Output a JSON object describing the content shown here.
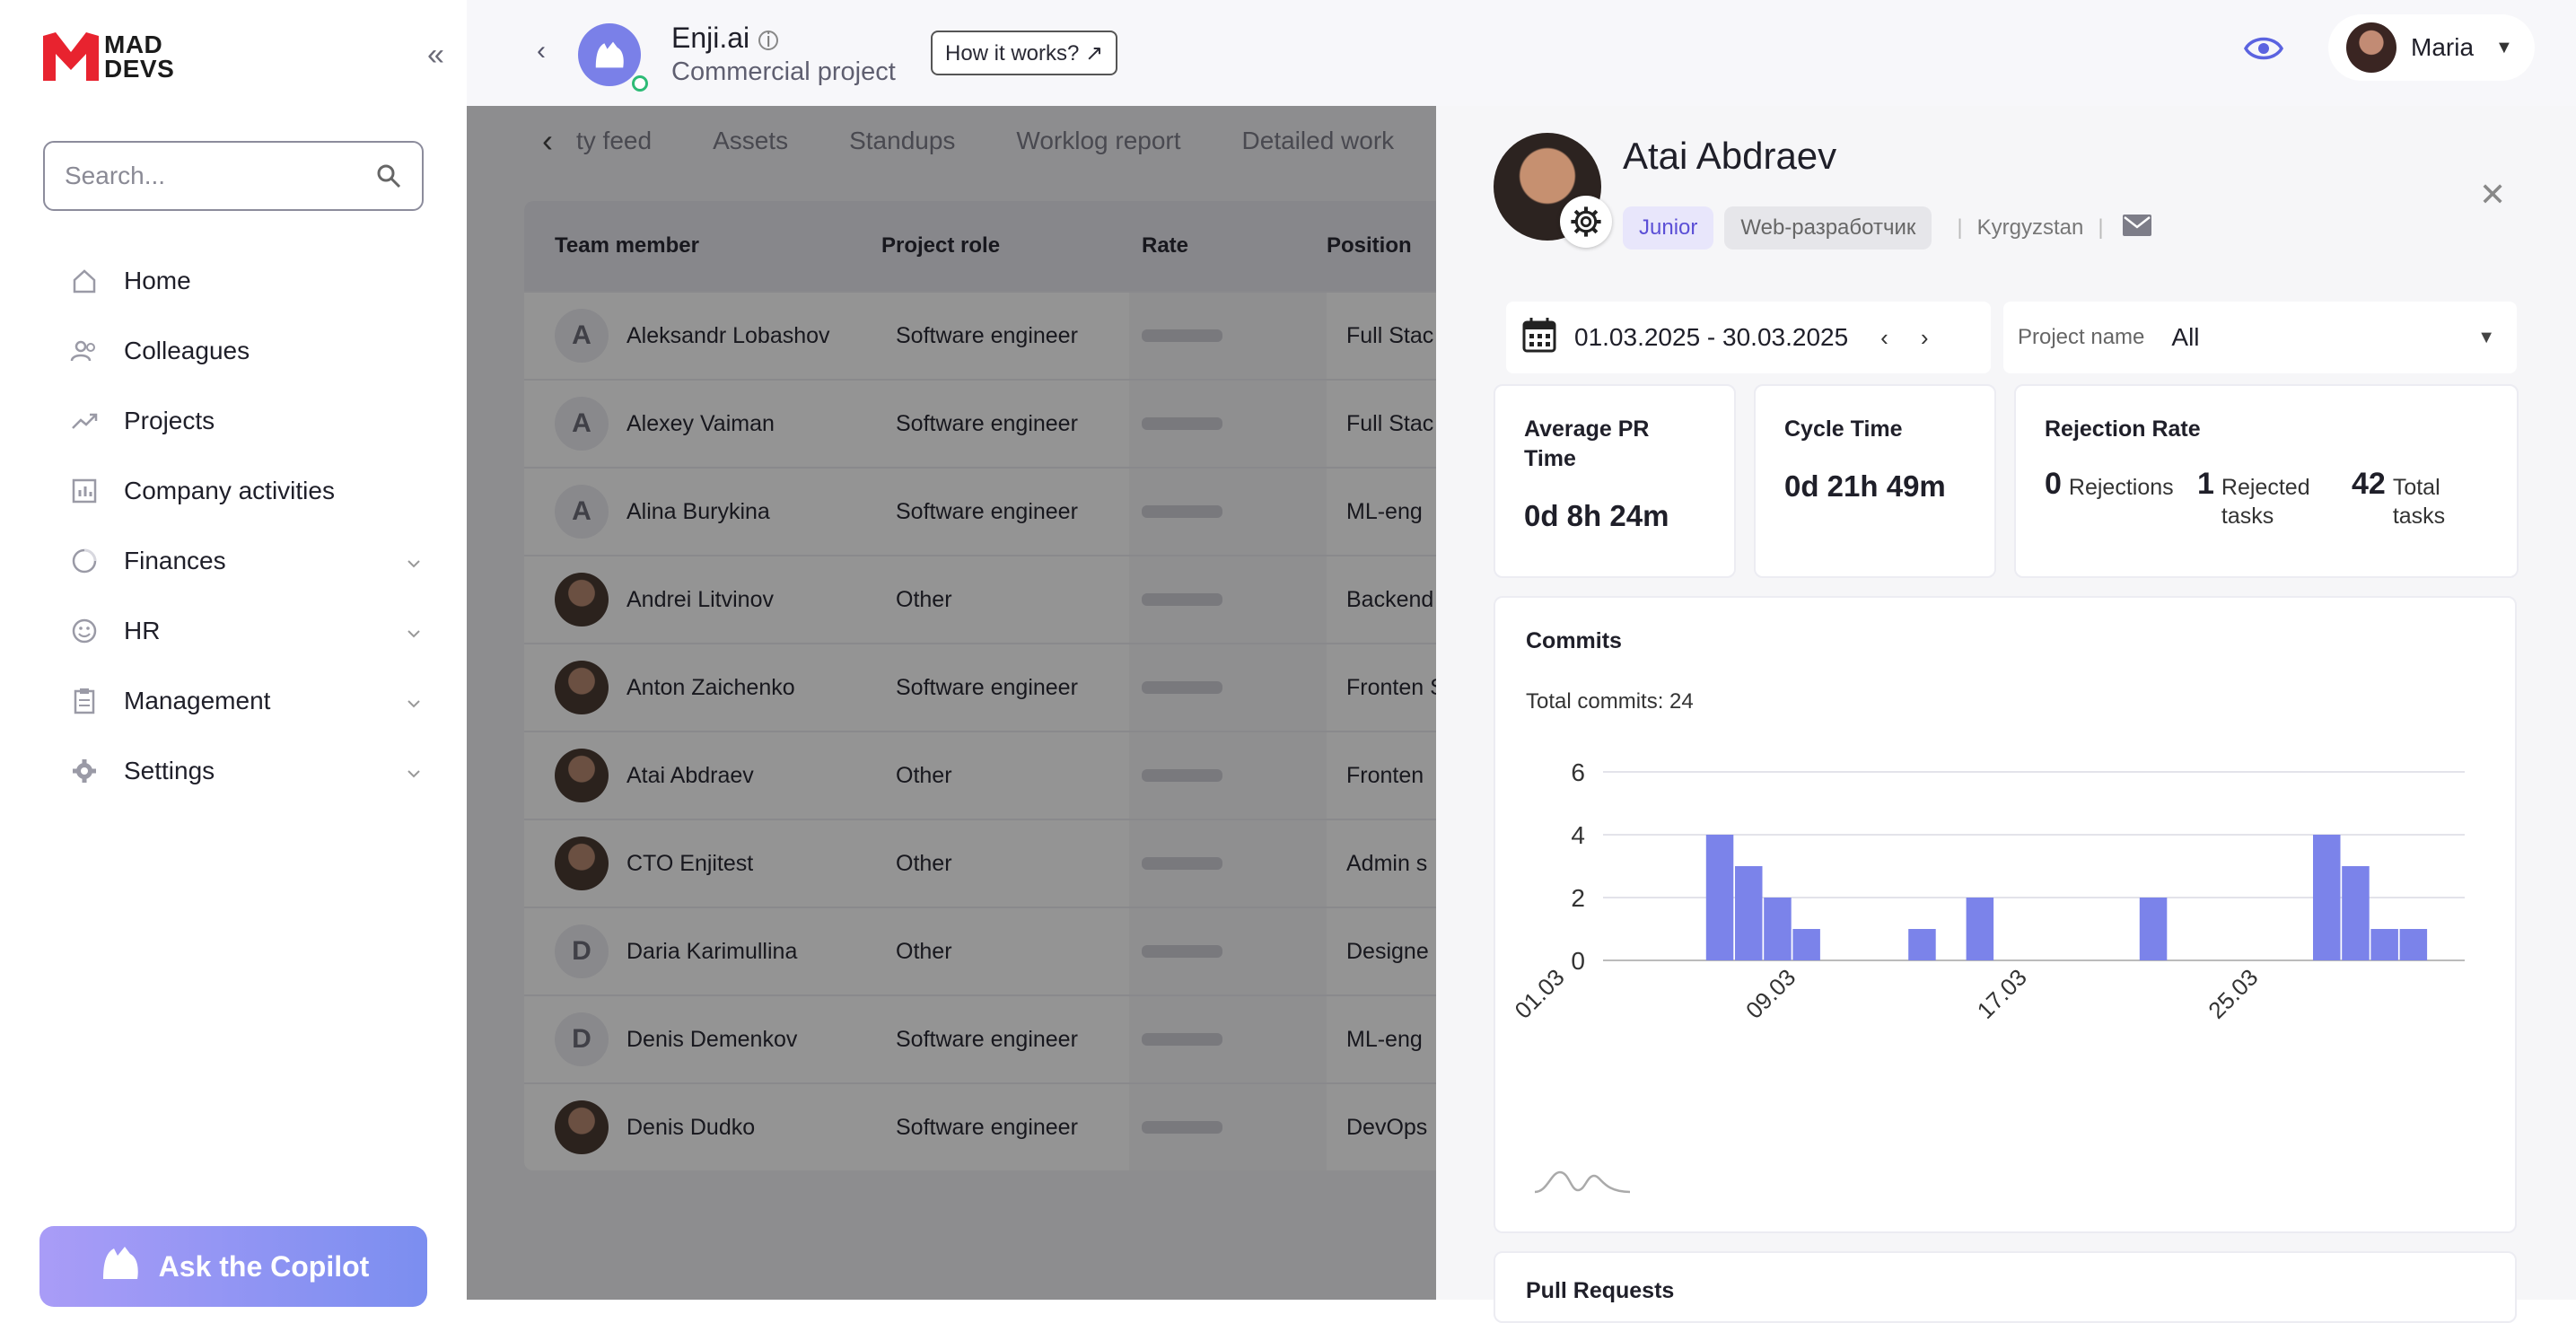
{
  "sidebar": {
    "logo_text": "MAD DEVS",
    "logo_line1": "MAD",
    "logo_line2": "DEVS",
    "search_placeholder": "Search...",
    "items": [
      {
        "label": "Home",
        "icon": "home-icon"
      },
      {
        "label": "Colleagues",
        "icon": "users-icon"
      },
      {
        "label": "Projects",
        "icon": "trend-icon"
      },
      {
        "label": "Company activities",
        "icon": "chart-icon"
      },
      {
        "label": "Finances",
        "icon": "pie-icon",
        "expandable": true
      },
      {
        "label": "HR",
        "icon": "smile-icon",
        "expandable": true
      },
      {
        "label": "Management",
        "icon": "clipboard-icon",
        "expandable": true
      },
      {
        "label": "Settings",
        "icon": "gear-icon",
        "expandable": true
      }
    ],
    "copilot_label": "Ask the Copilot"
  },
  "header": {
    "project_name": "Enji.ai",
    "project_type": "Commercial project",
    "how_label": "How it works? ↗",
    "user_name": "Maria"
  },
  "tabs": [
    "ty feed",
    "Assets",
    "Standups",
    "Worklog report",
    "Detailed work"
  ],
  "table": {
    "columns": [
      "Team member",
      "Project role",
      "Rate",
      "Position"
    ],
    "rows": [
      {
        "initial": "A",
        "name": "Aleksandr Lobashov",
        "role": "Software engineer",
        "position": "Full Stac"
      },
      {
        "initial": "A",
        "name": "Alexey Vaiman",
        "role": "Software engineer",
        "position": "Full Stac"
      },
      {
        "initial": "A",
        "name": "Alina Burykina",
        "role": "Software engineer",
        "position": "ML-eng"
      },
      {
        "initial": "",
        "name": "Andrei Litvinov",
        "role": "Other",
        "position": "Backend"
      },
      {
        "initial": "",
        "name": "Anton Zaichenko",
        "role": "Software engineer",
        "position": "Fronten Super E"
      },
      {
        "initial": "",
        "name": "Atai Abdraev",
        "role": "Other",
        "position": "Fronten"
      },
      {
        "initial": "",
        "name": "CTO Enjitest",
        "role": "Other",
        "position": "Admin s"
      },
      {
        "initial": "D",
        "name": "Daria Karimullina",
        "role": "Other",
        "position": "Designe"
      },
      {
        "initial": "D",
        "name": "Denis Demenkov",
        "role": "Software engineer",
        "position": "ML-eng"
      },
      {
        "initial": "",
        "name": "Denis Dudko",
        "role": "Software engineer",
        "position": "DevOps"
      }
    ]
  },
  "profile": {
    "name": "Atai Abdraev",
    "level": "Junior",
    "specialty": "Web-разработчик",
    "country": "Kyrgyzstan",
    "date_range": "01.03.2025 - 30.03.2025",
    "project_label": "Project name",
    "project_value": "All"
  },
  "metrics": {
    "avg_pr_title": "Average PR Time",
    "avg_pr_value": "0d 8h 24m",
    "cycle_title": "Cycle Time",
    "cycle_value": "0d 21h 49m",
    "rejection_title": "Rejection Rate",
    "rejections_num": "0",
    "rejections_label": "Rejections",
    "rejected_num": "1",
    "rejected_label": "Rejected tasks",
    "total_num": "42",
    "total_label": "Total tasks"
  },
  "commits": {
    "title": "Commits",
    "total_text": "Total commits: 24"
  },
  "pull_requests_title": "Pull Requests",
  "chart_data": {
    "type": "bar",
    "title": "Commits",
    "xlabel": "",
    "ylabel": "",
    "ylim": [
      0,
      6
    ],
    "yticks": [
      0,
      2,
      4,
      6
    ],
    "xticks": [
      "01.03",
      "09.03",
      "17.03",
      "25.03"
    ],
    "categories": [
      "01.03",
      "02.03",
      "03.03",
      "04.03",
      "05.03",
      "06.03",
      "07.03",
      "08.03",
      "09.03",
      "10.03",
      "11.03",
      "12.03",
      "13.03",
      "14.03",
      "15.03",
      "16.03",
      "17.03",
      "18.03",
      "19.03",
      "20.03",
      "21.03",
      "22.03",
      "23.03",
      "24.03",
      "25.03",
      "26.03",
      "27.03",
      "28.03",
      "29.03",
      "30.03"
    ],
    "values": [
      0,
      0,
      0,
      0,
      4,
      3,
      2,
      1,
      0,
      0,
      0,
      1,
      0,
      2,
      0,
      0,
      0,
      0,
      0,
      2,
      0,
      0,
      0,
      0,
      0,
      4,
      3,
      1,
      1,
      0
    ],
    "bar_color": "#7b83ea",
    "grid": true
  }
}
